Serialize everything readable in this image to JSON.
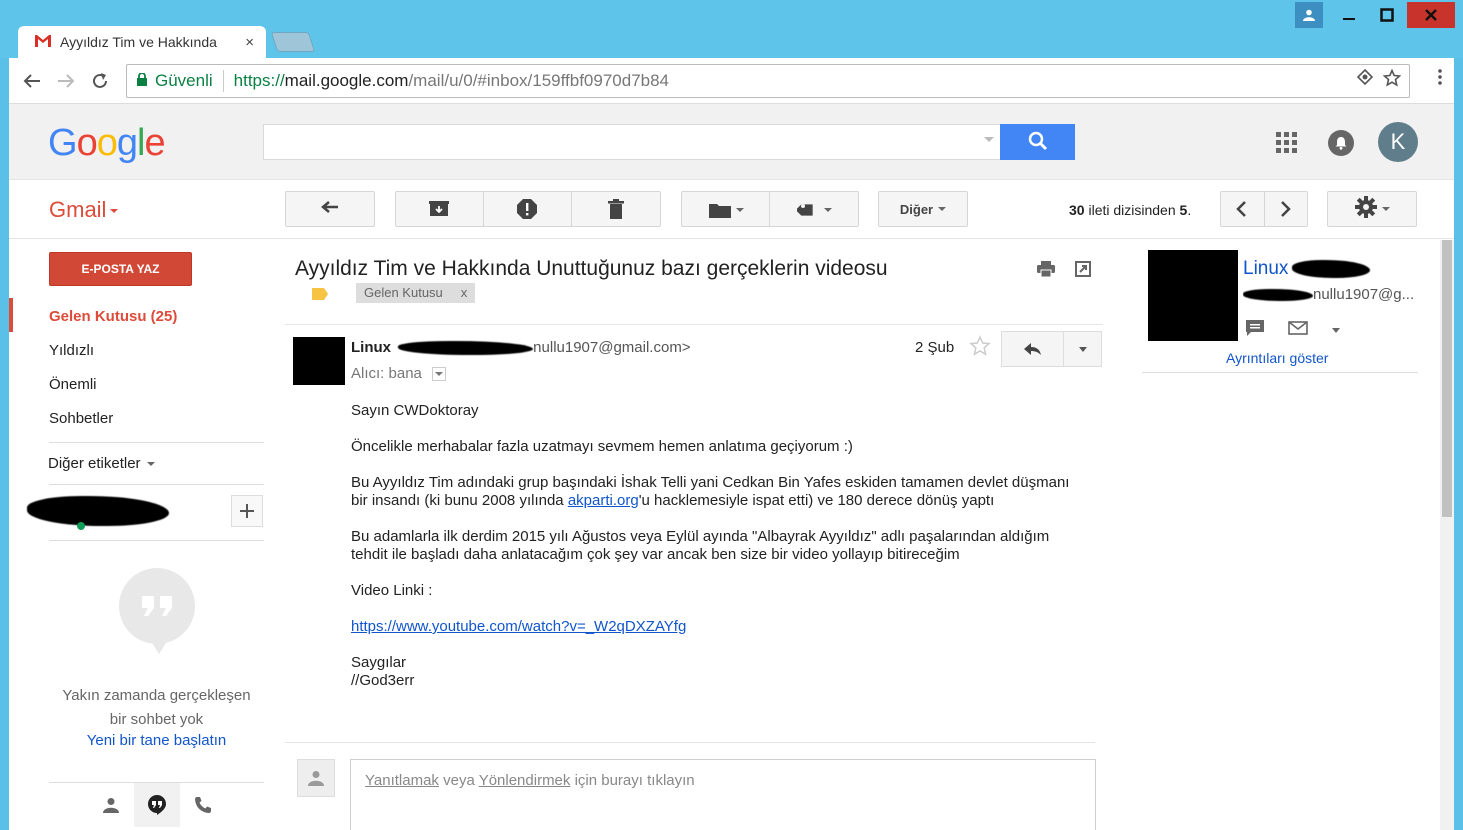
{
  "browser": {
    "tab_title": "Ayyıldız Tim ve Hakkında",
    "tab_close": "×",
    "secure_label": "Güvenli",
    "url_scheme": "https://",
    "url_host": "mail.google.com",
    "url_path": "/mail/u/0/#inbox/159ffbf0970d7b84"
  },
  "header": {
    "logo": [
      "G",
      "o",
      "o",
      "g",
      "l",
      "e"
    ],
    "avatar_letter": "K"
  },
  "toolbar": {
    "gmail_label": "Gmail",
    "more_label": "Diğer",
    "counter_total": "30",
    "counter_text": " ileti dizisinden ",
    "counter_current": "5",
    "counter_end": "."
  },
  "sidebar": {
    "compose": "E-POSTA YAZ",
    "items": [
      {
        "label": "Gelen Kutusu (25)"
      },
      {
        "label": "Yıldızlı"
      },
      {
        "label": "Önemli"
      },
      {
        "label": "Sohbetler"
      }
    ],
    "more_labels": "Diğer etiketler",
    "no_chat_line1": "Yakın zamanda gerçekleşen",
    "no_chat_line2": "bir sohbet yok",
    "start_chat": "Yeni bir tane başlatın"
  },
  "message": {
    "subject": "Ayyıldız Tim ve Hakkında Unuttuğunuz bazı gerçeklerin videosu",
    "label_chip": "Gelen Kutusu",
    "label_chip_close": "x",
    "sender_name": "Linux",
    "sender_email_visible": "nullu1907@gmail.com>",
    "to_label": "Alıcı: bana",
    "date": "2 Şub",
    "body": {
      "greeting": "Sayın CWDoktoray",
      "p1": "Öncelikle merhabalar fazla uzatmayı sevmem hemen anlatıma geçiyorum :)",
      "p2_before": "Bu Ayyıldız Tim adındaki grup başındaki İshak Telli yani Cedkan Bin Yafes eskiden tamamen devlet düşmanı bir insandı (ki bunu 2008 yılında ",
      "p2_link": "akparti.org",
      "p2_after": "'u hacklemesiyle ispat etti) ve 180 derece dönüş yaptı",
      "p3": "Bu adamlarla ilk derdim 2015 yılı Ağustos veya Eylül ayında \"Albayrak Ayyıldız\" adlı paşalarından aldığım tehdit ile başladı daha anlatacağım çok şey var ancak ben size bir video yollayıp bitireceğim",
      "video_label": "Video Linki :",
      "video_url": "https://www.youtube.com/watch?v=_W2qDXZAYfg",
      "closing": "Saygılar",
      "signature": "//God3err"
    },
    "reply_prompt": {
      "reply": "Yanıtlamak",
      "or": " veya ",
      "forward": "Yönlendirmek",
      "rest": " için burayı tıklayın"
    }
  },
  "contact_panel": {
    "name": "Linux",
    "email_visible": "nullu1907@g...",
    "details_link": "Ayrıntıları göster"
  },
  "colors": {
    "accent_red": "#dd4b39",
    "compose_red": "#d14836",
    "search_blue": "#4285f4",
    "link_blue": "#1155cc",
    "window_frame": "#5ec4ea"
  }
}
